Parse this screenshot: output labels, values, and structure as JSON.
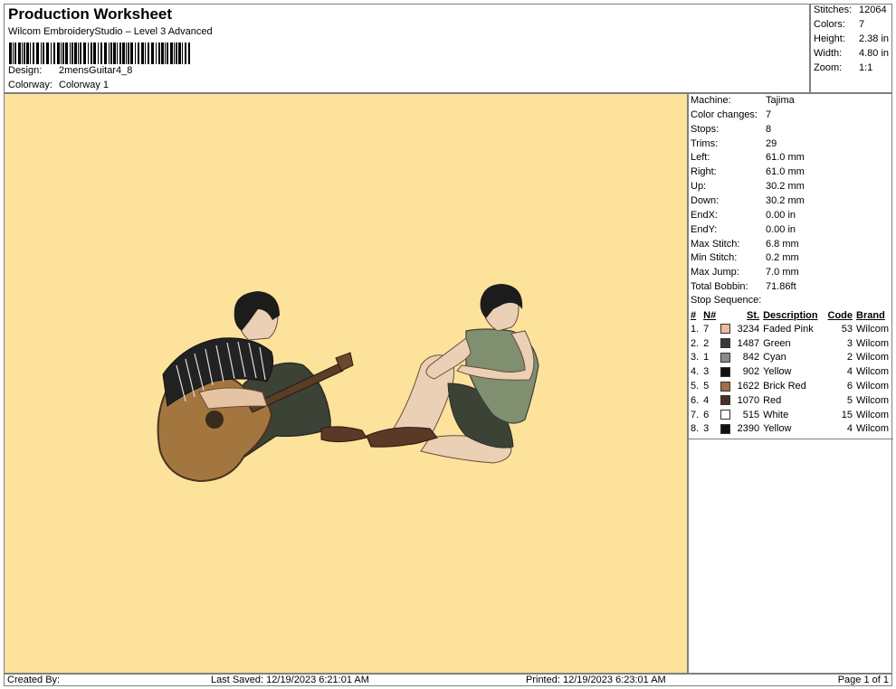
{
  "header": {
    "title": "Production Worksheet",
    "subtitle": "Wilcom EmbroideryStudio – Level 3 Advanced",
    "design_label": "Design:",
    "design_value": "2mensGuitar4_8",
    "colorway_label": "Colorway:",
    "colorway_value": "Colorway 1"
  },
  "summary": [
    {
      "label": "Stitches:",
      "value": "12064"
    },
    {
      "label": "Colors:",
      "value": "7"
    },
    {
      "label": "Height:",
      "value": "2.38 in"
    },
    {
      "label": "Width:",
      "value": "4.80 in"
    },
    {
      "label": "Zoom:",
      "value": "1:1"
    }
  ],
  "info": [
    {
      "label": "Machine:",
      "value": "Tajima"
    },
    {
      "label": "Color changes:",
      "value": "7"
    },
    {
      "label": "Stops:",
      "value": "8"
    },
    {
      "label": "Trims:",
      "value": "29"
    },
    {
      "label": "Left:",
      "value": "61.0 mm"
    },
    {
      "label": "Right:",
      "value": "61.0 mm"
    },
    {
      "label": "Up:",
      "value": "30.2 mm"
    },
    {
      "label": "Down:",
      "value": "30.2 mm"
    },
    {
      "label": "EndX:",
      "value": "0.00 in"
    },
    {
      "label": "EndY:",
      "value": "0.00 in"
    },
    {
      "label": "Max Stitch:",
      "value": "6.8 mm"
    },
    {
      "label": "Min Stitch:",
      "value": "0.2 mm"
    },
    {
      "label": "Max Jump:",
      "value": "7.0 mm"
    },
    {
      "label": "Total Bobbin:",
      "value": "71.86ft"
    }
  ],
  "stop_sequence": {
    "title": "Stop Sequence:",
    "columns": {
      "idx": "#",
      "n": "N#",
      "st": "St.",
      "desc": "Description",
      "code": "Code",
      "brand": "Brand"
    },
    "rows": [
      {
        "idx": "1.",
        "n": "7",
        "color": "#f2b8a0",
        "st": "3234",
        "desc": "Faded Pink",
        "code": "53",
        "brand": "Wilcom"
      },
      {
        "idx": "2.",
        "n": "2",
        "color": "#3b3b35",
        "st": "1487",
        "desc": "Green",
        "code": "3",
        "brand": "Wilcom"
      },
      {
        "idx": "3.",
        "n": "1",
        "color": "#8a8a87",
        "st": "842",
        "desc": "Cyan",
        "code": "2",
        "brand": "Wilcom"
      },
      {
        "idx": "4.",
        "n": "3",
        "color": "#111111",
        "st": "902",
        "desc": "Yellow",
        "code": "4",
        "brand": "Wilcom"
      },
      {
        "idx": "5.",
        "n": "5",
        "color": "#a0704a",
        "st": "1622",
        "desc": "Brick Red",
        "code": "6",
        "brand": "Wilcom"
      },
      {
        "idx": "6.",
        "n": "4",
        "color": "#4a2f22",
        "st": "1070",
        "desc": "Red",
        "code": "5",
        "brand": "Wilcom"
      },
      {
        "idx": "7.",
        "n": "6",
        "color": "#ffffff",
        "st": "515",
        "desc": "White",
        "code": "15",
        "brand": "Wilcom"
      },
      {
        "idx": "8.",
        "n": "3",
        "color": "#111111",
        "st": "2390",
        "desc": "Yellow",
        "code": "4",
        "brand": "Wilcom"
      }
    ]
  },
  "footer": {
    "created_by": "Created By:",
    "last_saved": "Last Saved: 12/19/2023 6:21:01 AM",
    "printed": "Printed: 12/19/2023 6:23:01 AM",
    "page": "Page 1 of 1"
  },
  "colors": {
    "canvas_bg": "#fde29c",
    "border": "#7f7f7f"
  }
}
